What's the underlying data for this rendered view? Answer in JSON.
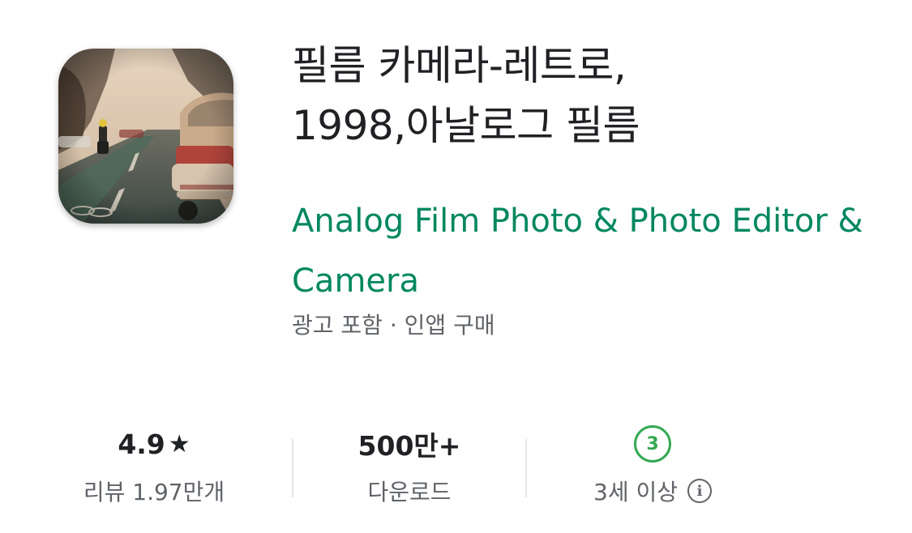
{
  "app": {
    "title_line1": "필름 카메라-레트로,",
    "title_line2": "1998,아날로그 필름",
    "developer": "Analog Film Photo & Photo Editor & Camera",
    "meta": "광고 포함 · 인앱 구매",
    "icon_name": "app-icon"
  },
  "stats": {
    "rating": {
      "value": "4.9",
      "icon": "star-icon",
      "label": "리뷰 1.97만개"
    },
    "downloads": {
      "value": "500만+",
      "label": "다운로드"
    },
    "age": {
      "badge": "3",
      "label": "3세 이상",
      "icon": "info-icon"
    }
  },
  "colors": {
    "developer": "#01875f",
    "age_badge": "#34a853",
    "secondary_text": "#5f6368"
  }
}
